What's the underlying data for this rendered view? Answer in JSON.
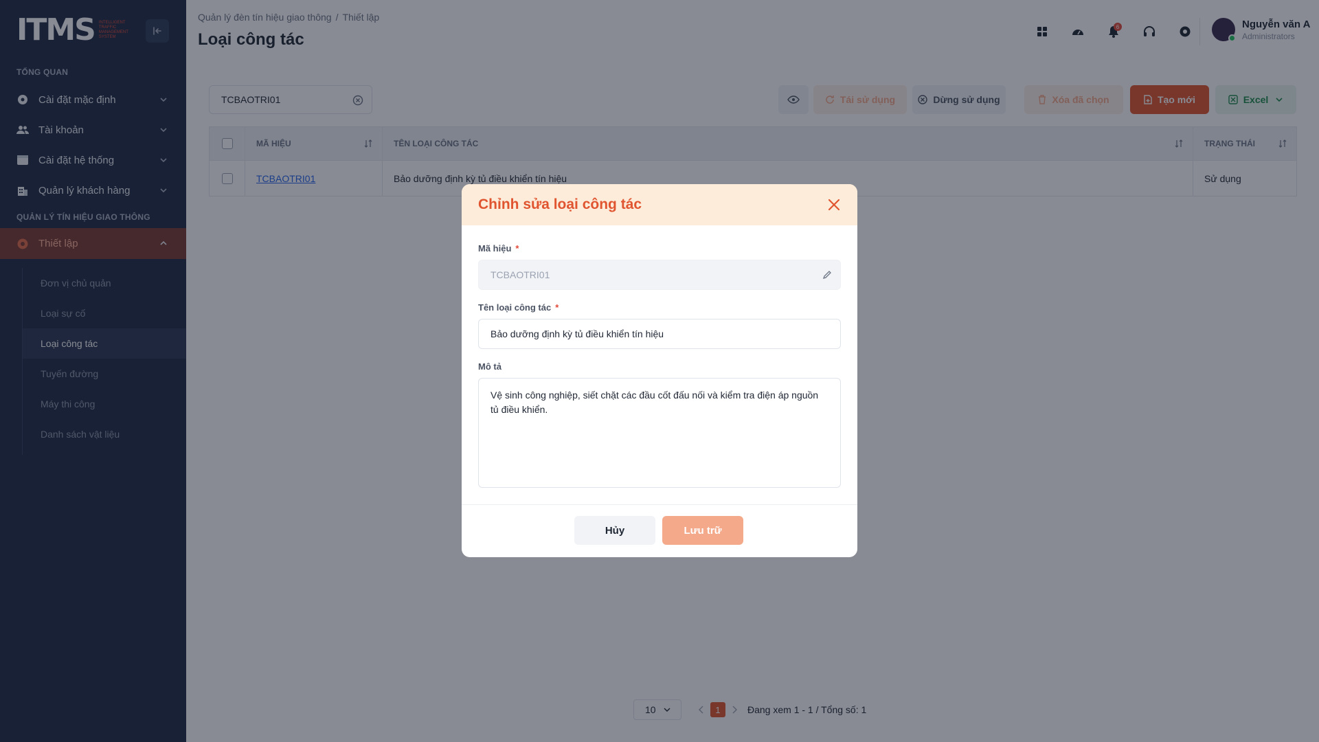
{
  "app": {
    "logo_text": "ITMS",
    "logo_sub": "Intelligent Traffic Management System"
  },
  "sidebar": {
    "section_overview": "TỔNG QUAN",
    "items": [
      {
        "label": "Cài đặt mặc định",
        "icon": "settings-icon"
      },
      {
        "label": "Tài khoản",
        "icon": "users-icon"
      },
      {
        "label": "Cài đặt hệ thống",
        "icon": "window-icon"
      },
      {
        "label": "Quản lý khách hàng",
        "icon": "building-icon"
      }
    ],
    "section_traffic": "QUẢN LÝ TÍN HIỆU GIAO THÔNG",
    "active_group": {
      "label": "Thiết lập",
      "icon": "gear-icon"
    },
    "sub_items": [
      {
        "label": "Đơn vị chủ quản"
      },
      {
        "label": "Loại sự cố"
      },
      {
        "label": "Loại công tác"
      },
      {
        "label": "Tuyến đường"
      },
      {
        "label": "Máy thi công"
      },
      {
        "label": "Danh sách vật liệu"
      }
    ]
  },
  "header": {
    "breadcrumb": [
      "Quản lý đèn tín hiệu giao thông",
      "Thiết lập"
    ],
    "title": "Loại công tác",
    "notification_count": "6",
    "user_name": "Nguyễn văn A",
    "user_role": "Administrators"
  },
  "toolbar": {
    "search_value": "TCBAOTRI01",
    "reuse": "Tái sử dụng",
    "stop_use": "Dừng sử dụng",
    "delete_selected": "Xóa đã chọn",
    "create_new": "Tạo mới",
    "excel": "Excel"
  },
  "table": {
    "columns": [
      "MÃ HIỆU",
      "TÊN LOẠI CÔNG TÁC",
      "TRẠNG THÁI"
    ],
    "rows": [
      {
        "code": "TCBAOTRI01",
        "name": "Bảo dưỡng định kỳ tủ điều khiển tín hiệu",
        "status": "Sử dụng"
      }
    ]
  },
  "pagination": {
    "page_size": "10",
    "current_page": "1",
    "summary": "Đang xem 1 - 1 / Tổng số: 1"
  },
  "modal": {
    "title": "Chỉnh sửa loại công tác",
    "code_label": "Mã hiệu",
    "code_value": "TCBAOTRI01",
    "name_label": "Tên loại công tác",
    "name_value": "Bảo dưỡng định kỳ tủ điều khiển tín hiệu",
    "desc_label": "Mô tả",
    "desc_value": "Vệ sinh công nghiệp, siết chặt các đầu cốt đấu nối và kiểm tra điện áp nguồn tủ điều khiển.",
    "required_mark": "*",
    "cancel": "Hủy",
    "save": "Lưu trữ"
  },
  "colors": {
    "accent": "#e0542f",
    "sidebar_bg": "#1f2a44",
    "modal_header_bg": "#fdecd9",
    "link": "#2563eb"
  }
}
